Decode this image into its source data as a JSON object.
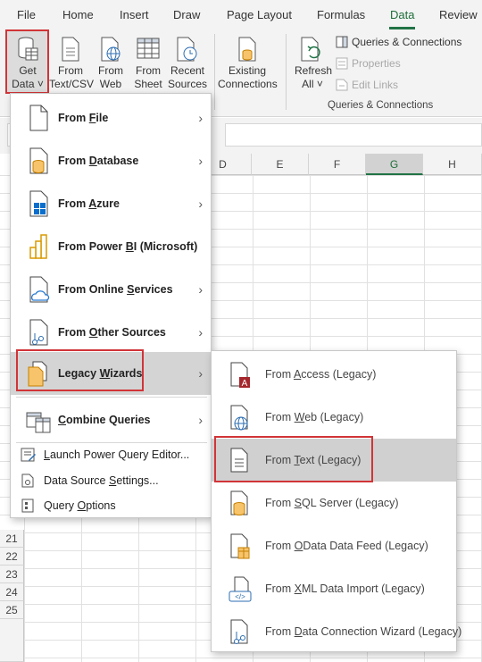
{
  "ribbon_tabs": [
    "File",
    "Home",
    "Insert",
    "Draw",
    "Page Layout",
    "Formulas",
    "Data",
    "Review"
  ],
  "active_tab": "Data",
  "ribbon": {
    "get_data": [
      "Get",
      "Data ˅"
    ],
    "from_text_csv": [
      "From",
      "Text/CSV"
    ],
    "from_web": [
      "From",
      "Web"
    ],
    "from_sheet": [
      "From",
      "Sheet"
    ],
    "recent_sources": [
      "Recent",
      "Sources"
    ],
    "existing_connections": [
      "Existing",
      "Connections"
    ],
    "refresh_all": [
      "Refresh",
      "All ˅"
    ],
    "queries_connections": "Queries & Connections",
    "properties": "Properties",
    "edit_links": "Edit Links",
    "group_label": "Queries & Connections"
  },
  "columns": [
    "D",
    "E",
    "F",
    "G",
    "H"
  ],
  "selected_column": "G",
  "rows": [
    "21",
    "22",
    "23",
    "24",
    "25"
  ],
  "get_data_menu": {
    "items": [
      {
        "pre": "From ",
        "u": "F",
        "post": "ile",
        "chevron": "›"
      },
      {
        "pre": "From ",
        "u": "D",
        "post": "atabase",
        "chevron": "›"
      },
      {
        "pre": "From ",
        "u": "A",
        "post": "zure",
        "chevron": "›"
      },
      {
        "pre": "From Power ",
        "u": "B",
        "post": "I (Microsoft)",
        "chevron": ""
      },
      {
        "pre": "From Online ",
        "u": "S",
        "post": "ervices",
        "chevron": "›"
      },
      {
        "pre": "From ",
        "u": "O",
        "post": "ther Sources",
        "chevron": "›"
      },
      {
        "pre": "Legacy ",
        "u": "W",
        "post": "izards",
        "chevron": "›"
      },
      {
        "pre": "",
        "u": "C",
        "post": "ombine Queries",
        "chevron": "›"
      }
    ],
    "small_items": [
      {
        "pre": "",
        "u": "L",
        "post": "aunch Power Query Editor..."
      },
      {
        "pre": "Data Source ",
        "u": "S",
        "post": "ettings..."
      },
      {
        "pre": "Query ",
        "u": "O",
        "post": "ptions"
      }
    ]
  },
  "legacy_menu": {
    "items": [
      {
        "pre": "From ",
        "u": "A",
        "post": "ccess (Legacy)"
      },
      {
        "pre": "From ",
        "u": "W",
        "post": "eb (Legacy)"
      },
      {
        "pre": "From ",
        "u": "T",
        "post": "ext (Legacy)"
      },
      {
        "pre": "From ",
        "u": "S",
        "post": "QL Server (Legacy)"
      },
      {
        "pre": "From ",
        "u": "O",
        "post": "Data Data Feed (Legacy)"
      },
      {
        "pre": "From ",
        "u": "X",
        "post": "ML Data Import (Legacy)"
      },
      {
        "pre": "From ",
        "u": "D",
        "post": "ata Connection Wizard (Legacy)"
      }
    ]
  },
  "colors": {
    "accent": "#217346",
    "highlight_border": "#d13438"
  }
}
